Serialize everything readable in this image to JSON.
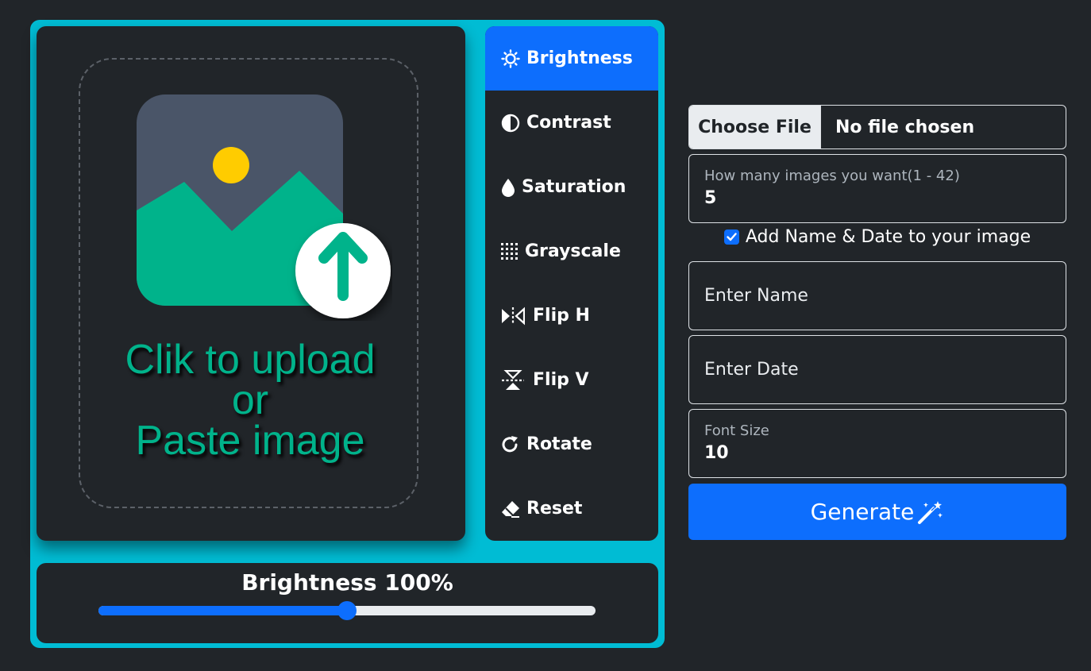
{
  "upload": {
    "line1": "Clik to upload",
    "line2": "or",
    "line3": "Paste image",
    "icon": "image-upload-icon"
  },
  "tools": [
    {
      "label": "Brightness",
      "icon": "sun-icon",
      "active": true
    },
    {
      "label": "Contrast",
      "icon": "contrast-icon",
      "active": false
    },
    {
      "label": "Saturation",
      "icon": "droplet-icon",
      "active": false
    },
    {
      "label": "Grayscale",
      "icon": "grid-icon",
      "active": false
    },
    {
      "label": "Flip H",
      "icon": "flip-horizontal-icon",
      "active": false
    },
    {
      "label": "Flip V",
      "icon": "flip-vertical-icon",
      "active": false
    },
    {
      "label": "Rotate",
      "icon": "rotate-icon",
      "active": false
    },
    {
      "label": "Reset",
      "icon": "eraser-icon",
      "active": false
    }
  ],
  "slider": {
    "label": "Brightness 100%",
    "value_fraction": 0.5
  },
  "form": {
    "file_button": "Choose File",
    "file_status": "No file chosen",
    "count_label": "How many images you want(1 - 42)",
    "count_value": "5",
    "checkbox_label": "Add Name & Date to your image",
    "checkbox_checked": true,
    "name_placeholder": "Enter Name",
    "date_placeholder": "Enter Date",
    "font_size_label": "Font Size",
    "font_size_value": "10",
    "generate_label": "Generate"
  },
  "colors": {
    "accent": "#0d6efd",
    "frame": "#00bcd4",
    "panel": "#212529",
    "upload_text": "#00b38b"
  }
}
